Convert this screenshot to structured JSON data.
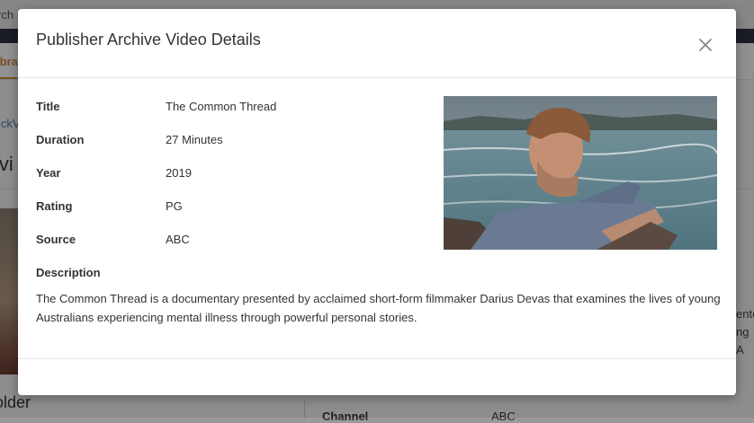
{
  "background": {
    "search_fragment": "rch",
    "nav_tab_fragment": "ibra",
    "link_fragment": "ickV",
    "heading_fragment": "lvi",
    "folder_fragment": "older",
    "right_text_line1": "ente",
    "right_text_line2": "ng A",
    "channel_label": "Channel",
    "channel_value": "ABC"
  },
  "modal": {
    "title": "Publisher Archive Video Details",
    "close_label": "×",
    "fields": [
      {
        "label": "Title",
        "value": "The Common Thread"
      },
      {
        "label": "Duration",
        "value": "27 Minutes"
      },
      {
        "label": "Year",
        "value": "2019"
      },
      {
        "label": "Rating",
        "value": "PG"
      },
      {
        "label": "Source",
        "value": "ABC"
      }
    ],
    "description_label": "Description",
    "description": "The Common Thread is a documentary presented by acclaimed short-form filmmaker Darius Devas that examines the lives of young Australians experiencing mental illness through powerful personal stories."
  },
  "colors": {
    "accent_orange": "#d08a3a",
    "dark_bar": "#2f3140",
    "link_blue": "#4a7ab0"
  },
  "icons": {
    "close": "close-icon"
  }
}
